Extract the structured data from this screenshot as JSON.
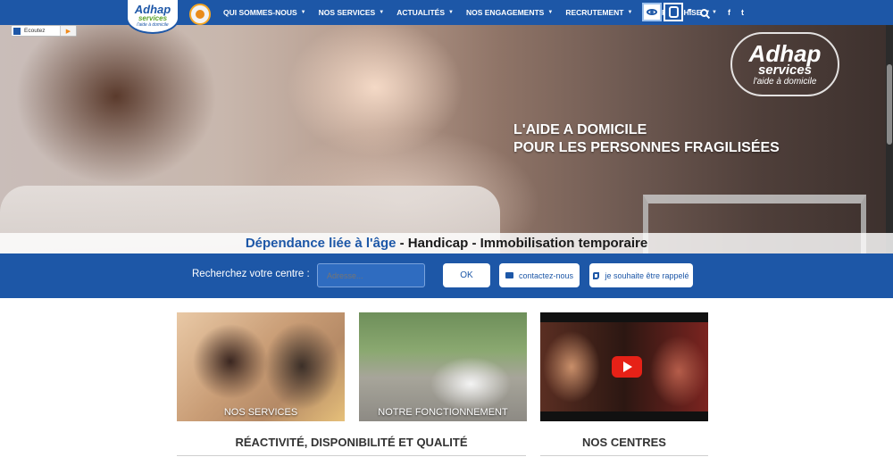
{
  "header": {
    "logo": {
      "line1": "Adhap",
      "line2": "services",
      "line3": "l'aide à domicile"
    },
    "nav": [
      {
        "label": "QUI SOMMES-NOUS"
      },
      {
        "label": "NOS SERVICES"
      },
      {
        "label": "ACTUALITÉS"
      },
      {
        "label": "NOS ENGAGEMENTS"
      },
      {
        "label": "RECRUTEMENT"
      },
      {
        "label": "LA FRANCHISE"
      }
    ],
    "icons": [
      "eye-accessibility-icon",
      "face-accessibility-icon",
      "search-icon",
      "facebook-icon",
      "twitter-icon"
    ],
    "facebook": "f",
    "twitter": "t"
  },
  "listen": {
    "label": "Ecoutez"
  },
  "hero": {
    "logo": {
      "line1": "Adhap",
      "line2": "services",
      "line3": "l'aide à domicile"
    },
    "title_line1": "L'AIDE A DOMICILE",
    "title_line2": "POUR LES PERSONNES FRAGILISÉES",
    "tagline_highlight": "Dépendance liée à l'âge",
    "tagline_rest": " - Handicap - Immobilisation temporaire"
  },
  "search": {
    "label": "Recherchez votre centre :",
    "placeholder": "Adresse...",
    "ok": "OK",
    "contact": "contactez-nous",
    "callback": "je souhaite être rappelé"
  },
  "cards": [
    {
      "label": "NOS SERVICES"
    },
    {
      "label": "NOTRE FONCTIONNEMENT"
    },
    {
      "label": ""
    }
  ],
  "sections": {
    "left": "RÉACTIVITÉ, DISPONIBILITÉ ET QUALITÉ",
    "right": "NOS CENTRES"
  },
  "colors": {
    "brand_blue": "#1d57a7",
    "brand_green": "#5aa32b",
    "accent_orange": "#f08a1c",
    "youtube_red": "#e62117"
  }
}
